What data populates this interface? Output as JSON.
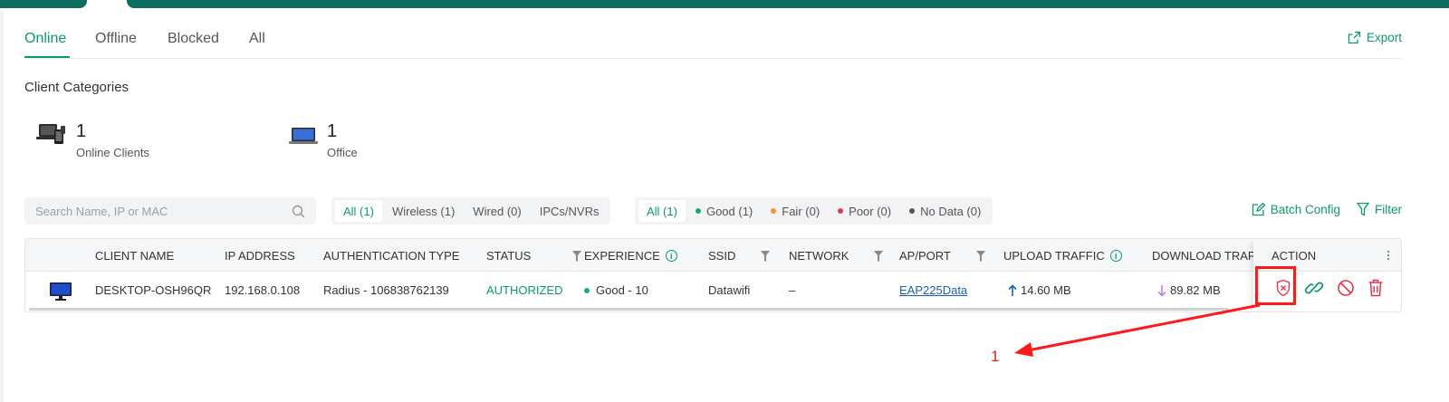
{
  "tabs": [
    {
      "label": "Online"
    },
    {
      "label": "Offline"
    },
    {
      "label": "Blocked"
    },
    {
      "label": "All"
    }
  ],
  "export_label": "Export",
  "client_categories": {
    "title": "Client Categories",
    "stats": [
      {
        "count": "1",
        "label": "Online Clients",
        "icon": "devices-icon"
      },
      {
        "count": "1",
        "label": "Office",
        "icon": "laptop-icon"
      }
    ]
  },
  "search": {
    "placeholder": "Search Name, IP or MAC"
  },
  "connection_filters": [
    "All (1)",
    "Wireless (1)",
    "Wired (0)",
    "IPCs/NVRs"
  ],
  "experience_filters": [
    {
      "label": "All (1)",
      "color": ""
    },
    {
      "label": "Good (1)",
      "color": "#1aaa6c"
    },
    {
      "label": "Fair (0)",
      "color": "#f5932b"
    },
    {
      "label": "Poor (0)",
      "color": "#e8344e"
    },
    {
      "label": "No Data (0)",
      "color": "#555555"
    }
  ],
  "toolbar": {
    "batch_config": "Batch Config",
    "filter": "Filter"
  },
  "table": {
    "columns": {
      "client_name": "CLIENT NAME",
      "ip_address": "IP ADDRESS",
      "auth_type": "AUTHENTICATION TYPE",
      "status": "STATUS",
      "experience": "EXPERIENCE",
      "ssid": "SSID",
      "network": "NETWORK",
      "ap_port": "AP/PORT",
      "upload": "UPLOAD TRAFFIC",
      "download": "DOWNLOAD TRAFF",
      "action": "ACTION"
    },
    "rows": [
      {
        "client_name": "DESKTOP-OSH96QR",
        "ip_address": "192.168.0.108",
        "auth_type": "Radius - 106838762139",
        "status": "AUTHORIZED",
        "experience": "Good - 10",
        "ssid": "Datawifi",
        "network": "–",
        "ap_port": "EAP225Data",
        "upload": "14.60 MB",
        "download": "89.82 MB"
      }
    ]
  },
  "annotation": {
    "label": "1"
  },
  "colors": {
    "accent": "#0a9a6b",
    "brand_bar": "#0b6e5f",
    "danger": "#e8344e",
    "upload_arrow": "#1a5fb4",
    "download_arrow": "#c77ddd",
    "annotation": "#ff1a1a"
  }
}
